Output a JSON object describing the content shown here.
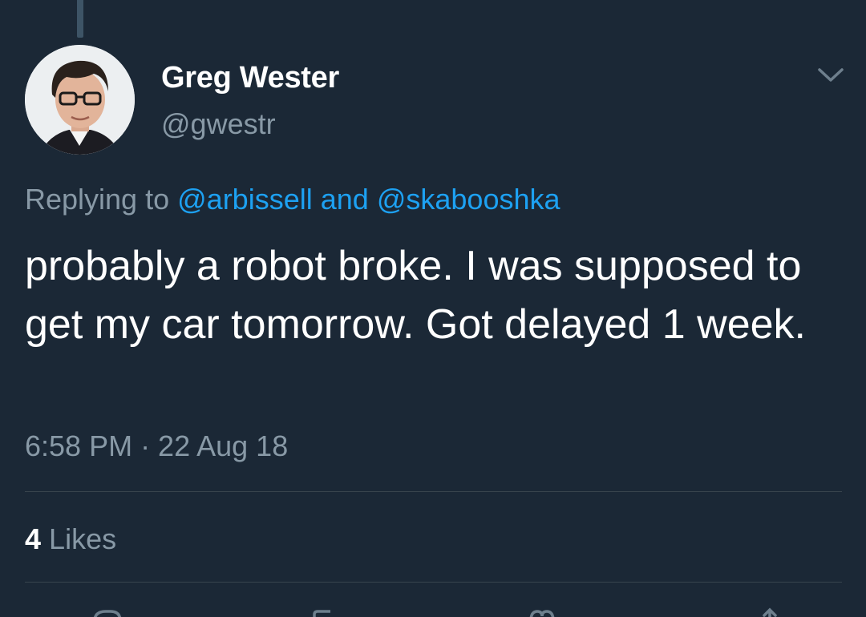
{
  "tweet": {
    "author": {
      "name": "Greg Wester",
      "handle": "@gwestr"
    },
    "replying": {
      "prefix": "Replying to",
      "mention_1": "@arbissell",
      "conjunction": "and",
      "mention_2": "@skabooshka"
    },
    "text": "probably a robot broke. I was supposed to get my car tomorrow. Got delayed 1 week.",
    "timestamp": "6:58 PM · 22 Aug 18",
    "likes": {
      "count": "4",
      "label": "Likes"
    }
  },
  "colors": {
    "background": "#1b2836",
    "text_primary": "#ffffff",
    "text_secondary": "#8899a6",
    "accent": "#1da1f2",
    "divider": "#38444d"
  },
  "icons": {
    "menu": "chevron-down-icon",
    "actions": [
      "reply-icon",
      "retweet-icon",
      "like-icon",
      "share-icon"
    ]
  }
}
